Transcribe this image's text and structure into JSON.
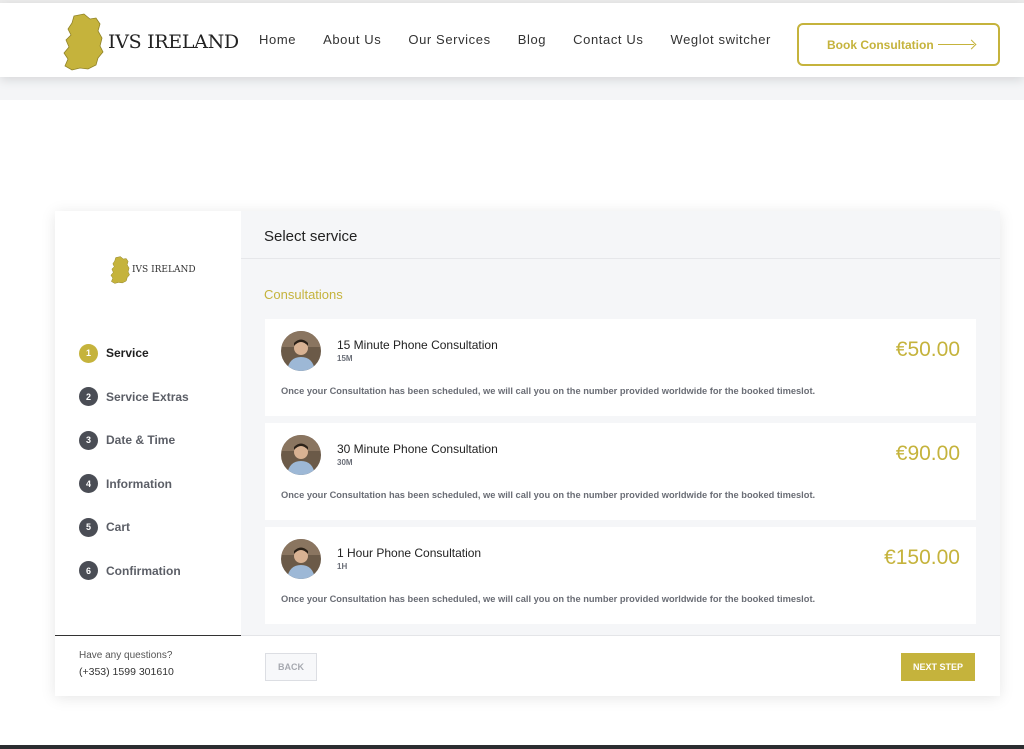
{
  "brand": {
    "name": "IVS IRELAND",
    "accent": "#c5b33c"
  },
  "nav": [
    "Home",
    "About Us",
    "Our Services",
    "Blog",
    "Contact Us",
    "Weglot switcher"
  ],
  "header": {
    "cta_label": "Book Consultation"
  },
  "booking": {
    "title": "Select service",
    "category": "Consultations",
    "steps": [
      {
        "num": "1",
        "label": "Service"
      },
      {
        "num": "2",
        "label": "Service Extras"
      },
      {
        "num": "3",
        "label": "Date & Time"
      },
      {
        "num": "4",
        "label": "Information"
      },
      {
        "num": "5",
        "label": "Cart"
      },
      {
        "num": "6",
        "label": "Confirmation"
      }
    ],
    "services": [
      {
        "name": "15 Minute Phone Consultation",
        "duration": "15M",
        "price": "€50.00",
        "description": "Once your Consultation has been scheduled, we will call you on the number provided worldwide for the booked timeslot."
      },
      {
        "name": "30 Minute Phone Consultation",
        "duration": "30M",
        "price": "€90.00",
        "description": "Once your Consultation has been scheduled, we will call you on the number provided worldwide for the booked timeslot."
      },
      {
        "name": "1 Hour Phone Consultation",
        "duration": "1H",
        "price": "€150.00",
        "description": "Once your Consultation has been scheduled, we will call you on the number provided worldwide for the booked timeslot."
      }
    ],
    "help": {
      "question": "Have any questions?",
      "phone": "(+353) 1599 301610"
    },
    "back_label": "BACK",
    "next_label": "NEXT STEP"
  }
}
